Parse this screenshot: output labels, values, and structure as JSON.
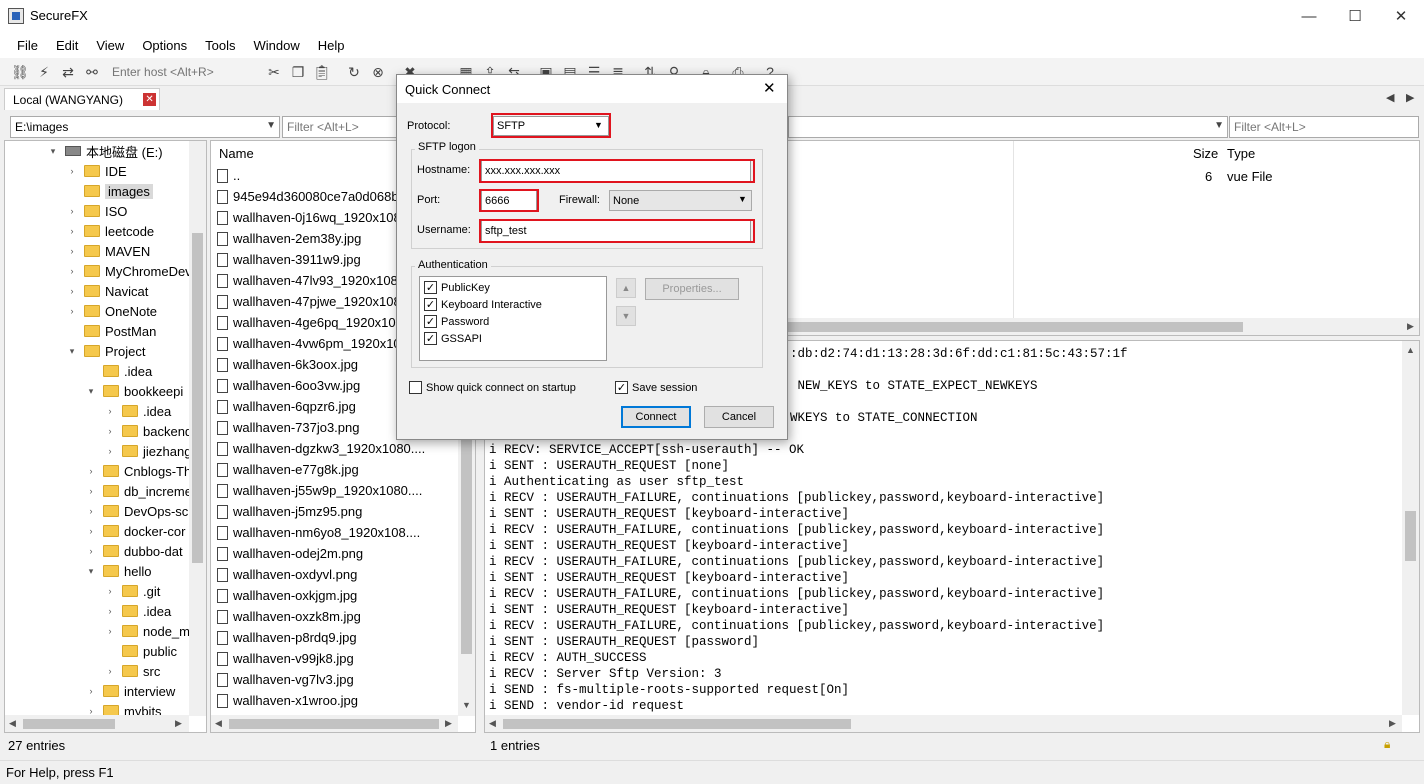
{
  "window": {
    "title": "SecureFX",
    "minimize": "—",
    "maximize": "☐",
    "close": "✕"
  },
  "menu": [
    "File",
    "Edit",
    "View",
    "Options",
    "Tools",
    "Window",
    "Help"
  ],
  "toolbar": {
    "host_placeholder": "Enter host <Alt+R>"
  },
  "left_pane": {
    "tab_label": "Local (WANGYANG)",
    "path": "E:\\images",
    "filter_placeholder": "Filter <Alt+L>",
    "column_name": "Name",
    "tree": [
      {
        "label": "本地磁盘 (E:)",
        "depth": 0,
        "expander": "▾",
        "kind": "drive"
      },
      {
        "label": "IDE",
        "depth": 1,
        "expander": "›",
        "kind": "folder"
      },
      {
        "label": "images",
        "depth": 1,
        "expander": "",
        "kind": "folder",
        "selected": true
      },
      {
        "label": "ISO",
        "depth": 1,
        "expander": "›",
        "kind": "folder"
      },
      {
        "label": "leetcode",
        "depth": 1,
        "expander": "›",
        "kind": "folder"
      },
      {
        "label": "MAVEN",
        "depth": 1,
        "expander": "›",
        "kind": "folder"
      },
      {
        "label": "MyChromeDev",
        "depth": 1,
        "expander": "›",
        "kind": "folder"
      },
      {
        "label": "Navicat",
        "depth": 1,
        "expander": "›",
        "kind": "folder"
      },
      {
        "label": "OneNote",
        "depth": 1,
        "expander": "›",
        "kind": "folder"
      },
      {
        "label": "PostMan",
        "depth": 1,
        "expander": "",
        "kind": "folder"
      },
      {
        "label": "Project",
        "depth": 1,
        "expander": "▾",
        "kind": "folder"
      },
      {
        "label": ".idea",
        "depth": 2,
        "expander": "",
        "kind": "folder"
      },
      {
        "label": "bookkeepi",
        "depth": 2,
        "expander": "▾",
        "kind": "folder"
      },
      {
        "label": ".idea",
        "depth": 3,
        "expander": "›",
        "kind": "folder"
      },
      {
        "label": "backend",
        "depth": 3,
        "expander": "›",
        "kind": "folder"
      },
      {
        "label": "jiezhang",
        "depth": 3,
        "expander": "›",
        "kind": "folder"
      },
      {
        "label": "Cnblogs-Th",
        "depth": 2,
        "expander": "›",
        "kind": "folder"
      },
      {
        "label": "db_increme",
        "depth": 2,
        "expander": "›",
        "kind": "folder"
      },
      {
        "label": "DevOps-sc",
        "depth": 2,
        "expander": "›",
        "kind": "folder"
      },
      {
        "label": "docker-cor",
        "depth": 2,
        "expander": "›",
        "kind": "folder"
      },
      {
        "label": "dubbo-dat",
        "depth": 2,
        "expander": "›",
        "kind": "folder"
      },
      {
        "label": "hello",
        "depth": 2,
        "expander": "▾",
        "kind": "folder"
      },
      {
        "label": ".git",
        "depth": 3,
        "expander": "›",
        "kind": "folder"
      },
      {
        "label": ".idea",
        "depth": 3,
        "expander": "›",
        "kind": "folder"
      },
      {
        "label": "node_m",
        "depth": 3,
        "expander": "›",
        "kind": "folder"
      },
      {
        "label": "public",
        "depth": 3,
        "expander": "",
        "kind": "folder"
      },
      {
        "label": "src",
        "depth": 3,
        "expander": "›",
        "kind": "folder"
      },
      {
        "label": "interview",
        "depth": 2,
        "expander": "›",
        "kind": "folder"
      },
      {
        "label": "mybits",
        "depth": 2,
        "expander": "›",
        "kind": "folder"
      }
    ],
    "files": [
      "..",
      "945e94d360080ce7a0d068b",
      "wallhaven-0j16wq_1920x108",
      "wallhaven-2em38y.jpg",
      "wallhaven-3911w9.jpg",
      "wallhaven-47lv93_1920x1080",
      "wallhaven-47pjwe_1920x108",
      "wallhaven-4ge6pq_1920x108",
      "wallhaven-4vw6pm_1920x108",
      "wallhaven-6k3oox.jpg",
      "wallhaven-6oo3vw.jpg",
      "wallhaven-6qpzr6.jpg",
      "wallhaven-737jo3.png",
      "wallhaven-dgzkw3_1920x1080....",
      "wallhaven-e77g8k.jpg",
      "wallhaven-j55w9p_1920x1080....",
      "wallhaven-j5mz95.png",
      "wallhaven-nm6yo8_1920x108....",
      "wallhaven-odej2m.png",
      "wallhaven-oxdyvl.png",
      "wallhaven-oxkjgm.jpg",
      "wallhaven-oxzk8m.jpg",
      "wallhaven-p8rdq9.jpg",
      "wallhaven-v99jk8.jpg",
      "wallhaven-vg7lv3.jpg",
      "wallhaven-x1wroo.jpg"
    ],
    "entries": "27 entries"
  },
  "right_pane": {
    "filter_placeholder": "Filter <Alt+L>",
    "columns": {
      "size": "Size",
      "type": "Type"
    },
    "row": {
      "size": "6",
      "type": "vue File"
    },
    "entries": "1 entries"
  },
  "log": [
    ":db:d2:74:d1:13:28:3d:6f:dd:c1:81:5c:43:57:1f",
    "",
    " NEW_KEYS to STATE_EXPECT_NEWKEYS",
    "",
    "WKEYS to STATE_CONNECTION",
    "",
    "i RECV: SERVICE_ACCEPT[ssh-userauth] -- OK",
    "i SENT : USERAUTH_REQUEST [none]",
    "i Authenticating as user sftp_test",
    "i RECV : USERAUTH_FAILURE, continuations [publickey,password,keyboard-interactive]",
    "i SENT : USERAUTH_REQUEST [keyboard-interactive]",
    "i RECV : USERAUTH_FAILURE, continuations [publickey,password,keyboard-interactive]",
    "i SENT : USERAUTH_REQUEST [keyboard-interactive]",
    "i RECV : USERAUTH_FAILURE, continuations [publickey,password,keyboard-interactive]",
    "i SENT : USERAUTH_REQUEST [keyboard-interactive]",
    "i RECV : USERAUTH_FAILURE, continuations [publickey,password,keyboard-interactive]",
    "i SENT : USERAUTH_REQUEST [keyboard-interactive]",
    "i RECV : USERAUTH_FAILURE, continuations [publickey,password,keyboard-interactive]",
    "i SENT : USERAUTH_REQUEST [password]",
    "i RECV : AUTH_SUCCESS",
    "i RECV : Server Sftp Version: 3",
    "i SEND : fs-multiple-roots-supported request[On]",
    "i SEND : vendor-id request"
  ],
  "status": {
    "help": "For Help, press F1"
  },
  "dialog": {
    "title": "Quick Connect",
    "protocol_label": "Protocol:",
    "protocol_value": "SFTP",
    "sftp_group": "SFTP logon",
    "hostname_label": "Hostname:",
    "hostname_value": "xxx.xxx.xxx.xxx",
    "port_label": "Port:",
    "port_value": "6666",
    "firewall_label": "Firewall:",
    "firewall_value": "None",
    "username_label": "Username:",
    "username_value": "sftp_test",
    "auth_group": "Authentication",
    "auth_methods": [
      "PublicKey",
      "Keyboard Interactive",
      "Password",
      "GSSAPI"
    ],
    "properties_button": "Properties...",
    "show_on_startup": "Show quick connect on startup",
    "save_session": "Save session",
    "connect_button": "Connect",
    "cancel_button": "Cancel",
    "highlight_color": "#e0141e"
  }
}
